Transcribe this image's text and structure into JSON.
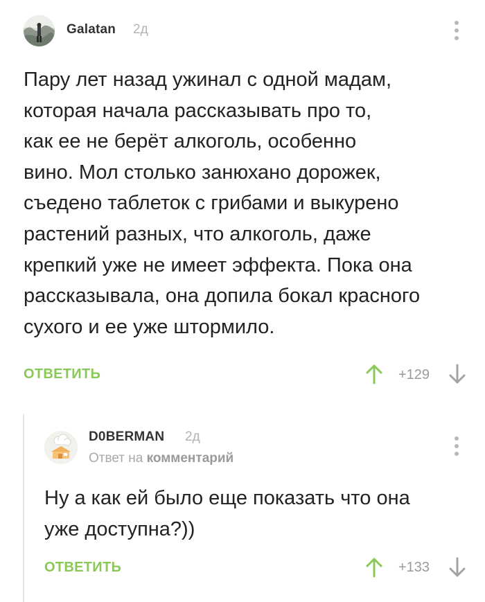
{
  "comments": [
    {
      "username": "Galatan",
      "time": "2д",
      "text": "Пару лет назад ужинал с одной мадам,\nкоторая начала рассказывать про то,\nкак ее не берёт алкоголь, особенно\nвино. Мол столько занюхано дорожек,\nсъедено таблеток с грибами и выкурено\nрастений разных, что алкоголь, даже\nкрепкий уже не имеет эффекта. Пока она\nрассказывала, она допила бокал красного\nсухого и ее уже штормило.",
      "reply_label": "ОТВЕТИТЬ",
      "rating": "+129"
    },
    {
      "username": "D0BERMAN",
      "time": "2д",
      "reply_to_prefix": "Ответ на",
      "reply_to_target": "комментарий",
      "text": "Ну а как ей было еще показать что она\nуже доступна?))",
      "reply_label": "ОТВЕТИТЬ",
      "rating": "+133"
    }
  ],
  "colors": {
    "accent_green": "#8ac858",
    "muted_gray": "#b3b3b3"
  },
  "icons": [
    "avatar-photo",
    "kebab-menu-icon",
    "arrow-up-icon",
    "arrow-down-icon",
    "avatar-cloud-house"
  ]
}
